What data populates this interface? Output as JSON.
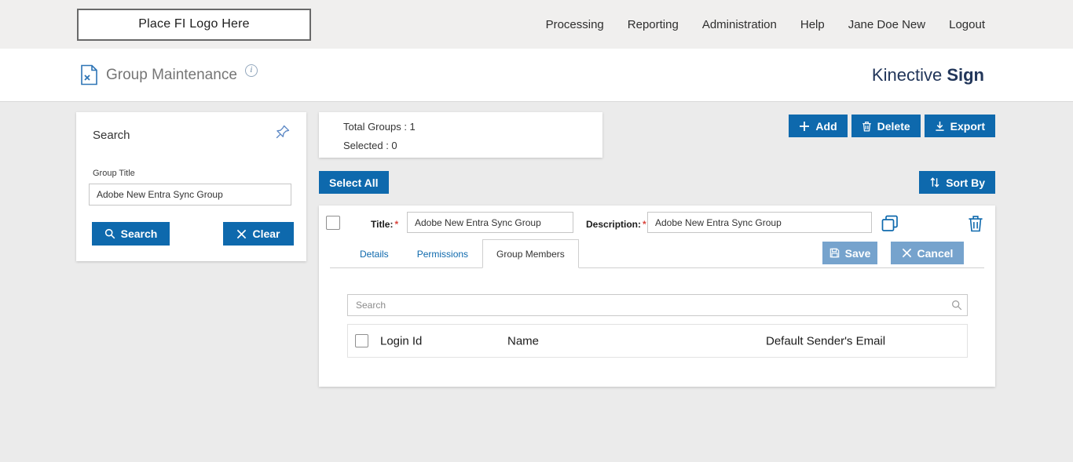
{
  "topbar": {
    "logo_placeholder": "Place FI Logo Here",
    "nav": [
      {
        "label": "Processing"
      },
      {
        "label": "Reporting"
      },
      {
        "label": "Administration"
      },
      {
        "label": "Help"
      },
      {
        "label": "Jane Doe New"
      },
      {
        "label": "Logout"
      }
    ]
  },
  "header": {
    "title": "Group Maintenance",
    "brand_name": "Kinective",
    "brand_bold": "Sign"
  },
  "search_panel": {
    "title": "Search",
    "group_title_label": "Group Title",
    "group_title_value": "Adobe New Entra Sync Group",
    "search_button": "Search",
    "clear_button": "Clear"
  },
  "summary": {
    "total_groups": "Total Groups : 1",
    "selected": "Selected : 0"
  },
  "toolbar": {
    "add": "Add",
    "delete": "Delete",
    "export": "Export",
    "select_all": "Select All",
    "sort_by": "Sort By"
  },
  "group_editor": {
    "title_label": "Title:",
    "description_label": "Description:",
    "required_marker": "*",
    "title_value": "Adobe New Entra Sync Group",
    "description_value": "Adobe New Entra Sync Group",
    "tabs": [
      {
        "label": "Details"
      },
      {
        "label": "Permissions"
      },
      {
        "label": "Group Members"
      }
    ],
    "save_button": "Save",
    "cancel_button": "Cancel",
    "member_search_placeholder": "Search",
    "table_columns": [
      "Login Id",
      "Name",
      "Default Sender's Email"
    ]
  },
  "colors": {
    "accent": "#0e69ad",
    "accent_soft": "#76a3cd",
    "brand_navy": "#22365a",
    "page_bg": "#ebebeb",
    "topbar_bg": "#f0efee",
    "required": "#d9453d"
  }
}
